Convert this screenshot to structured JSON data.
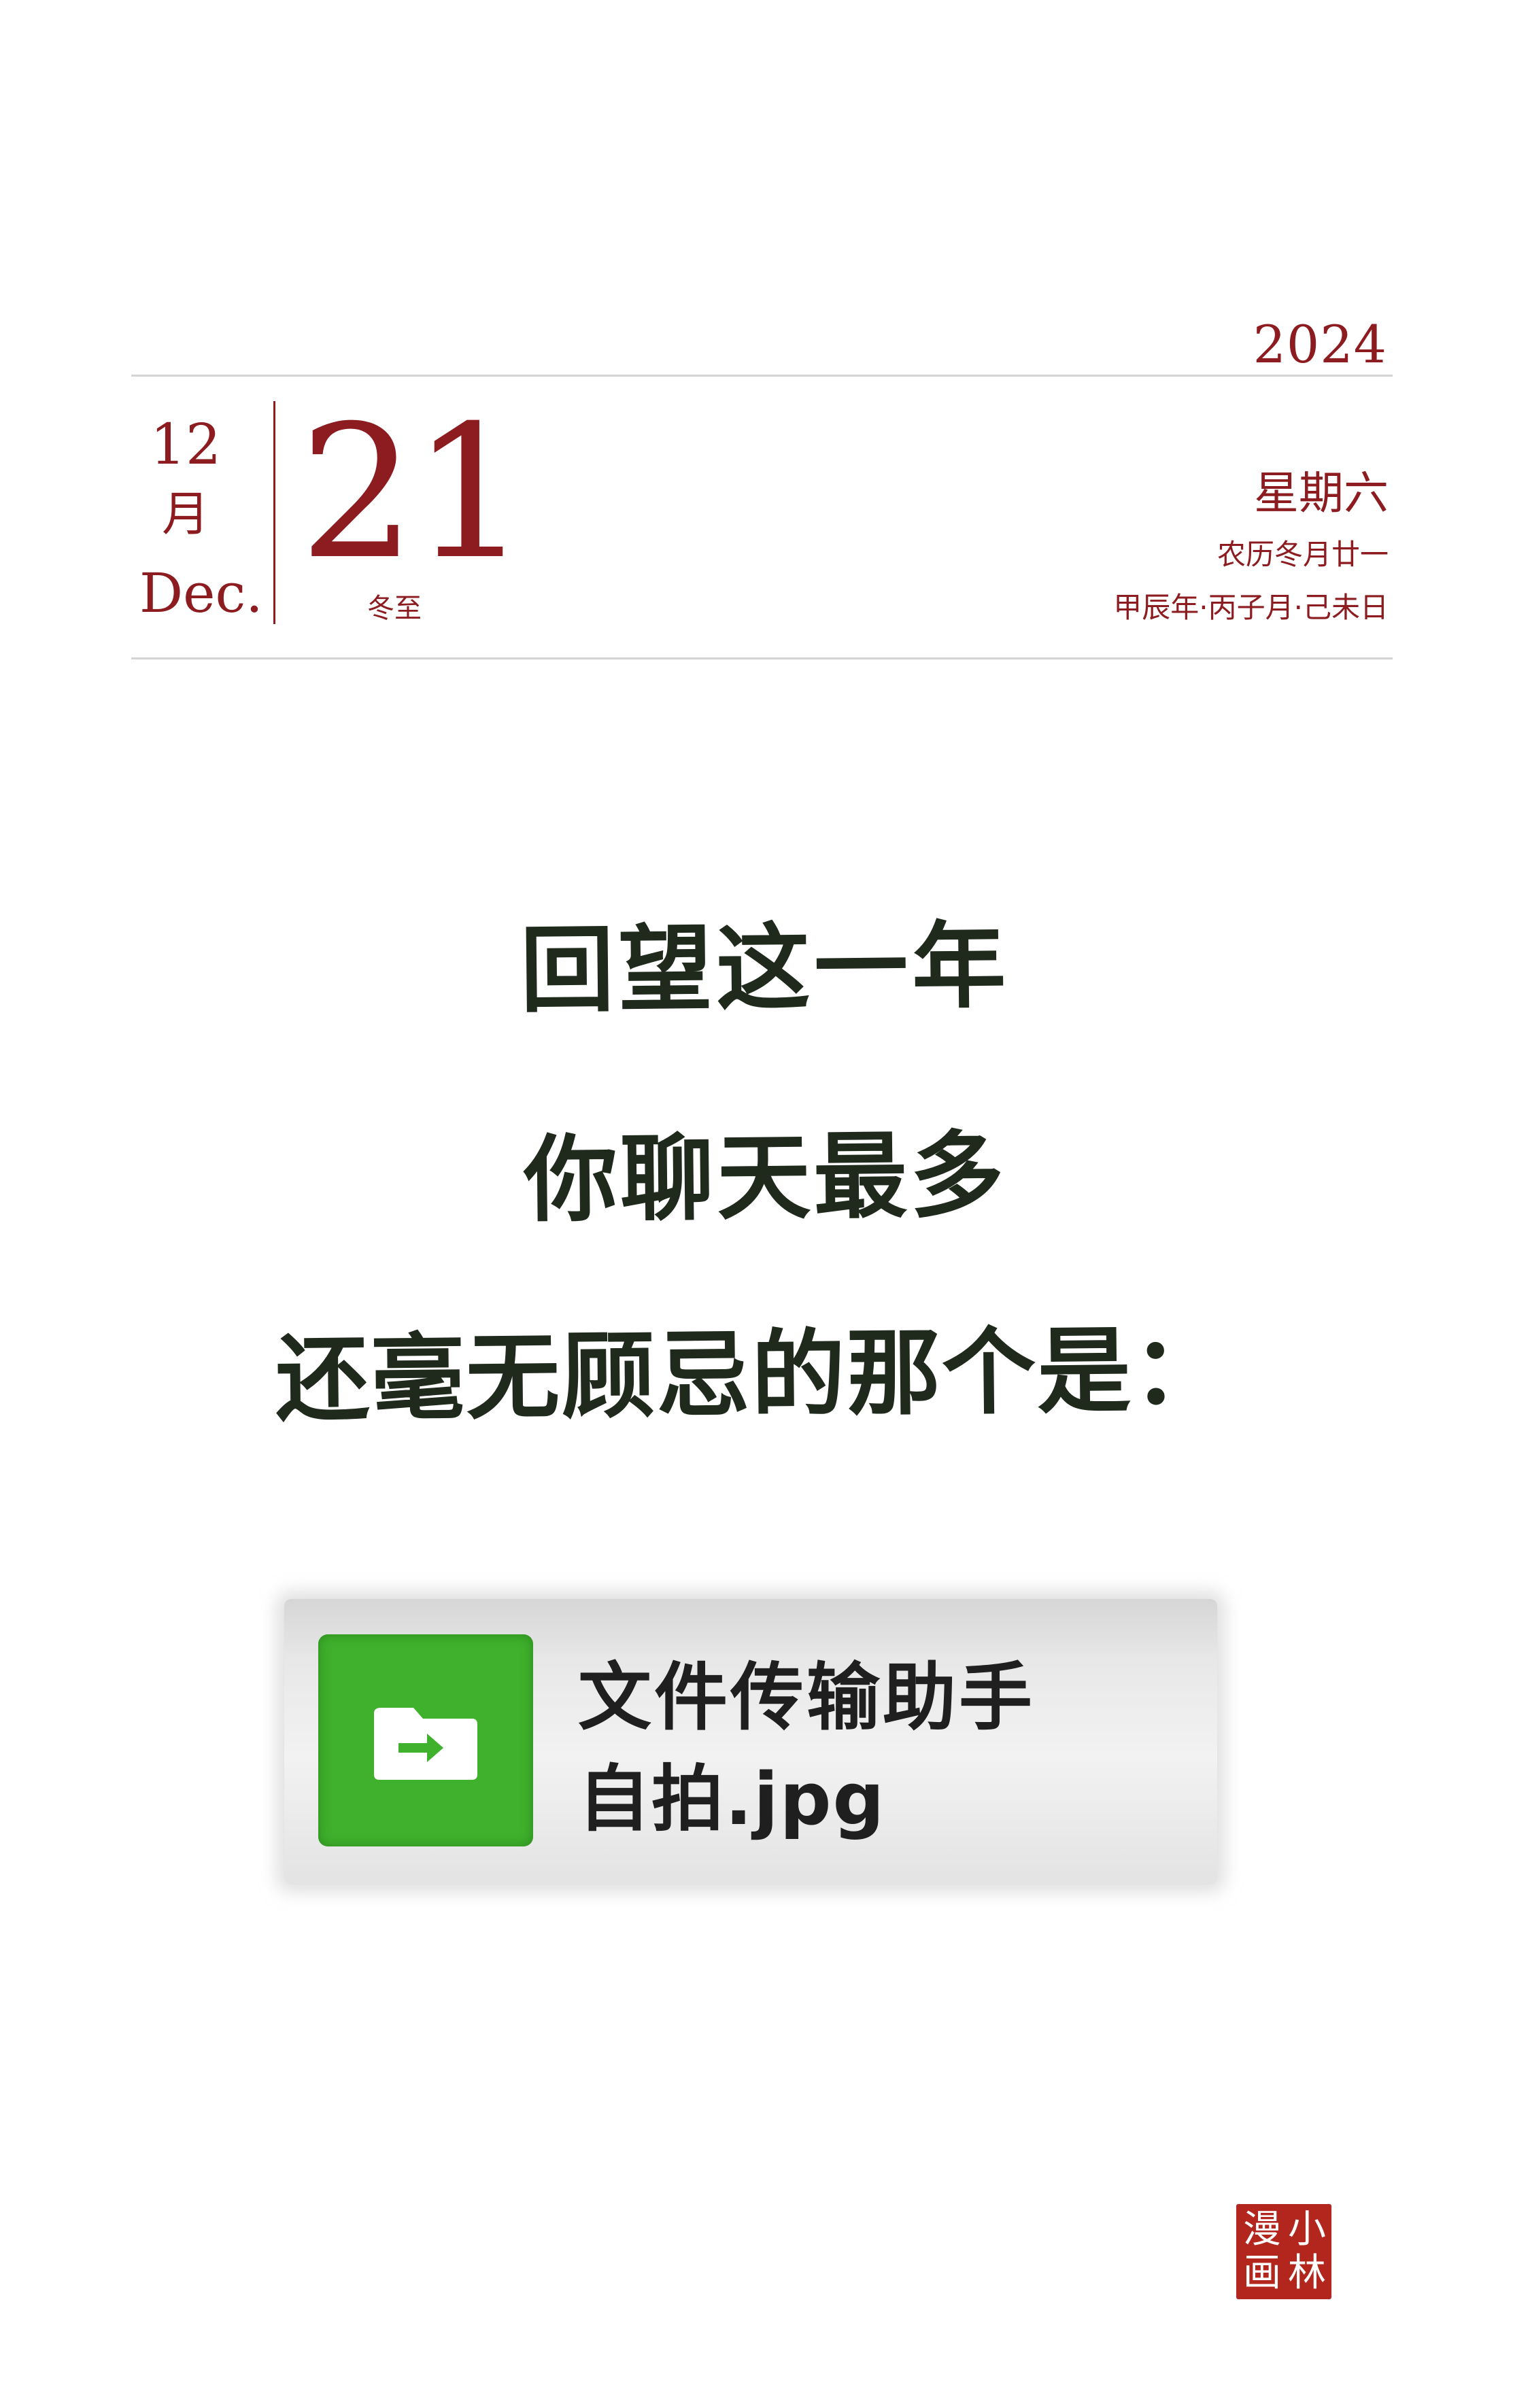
{
  "calendar": {
    "year": "2024",
    "month_num": "12",
    "month_cn": "月",
    "month_en": "Dec.",
    "day": "21",
    "solar_term": "冬至",
    "weekday": "星期六",
    "lunar_date": "农历冬月廿一",
    "ganzhi": "甲辰年·丙子月·己未日"
  },
  "message": {
    "line1": "回望这一年",
    "line2": "你聊天最多",
    "line3": "还毫无顾忌的那个是："
  },
  "chat_card": {
    "name": "文件传输助手",
    "last_message": "自拍.jpg",
    "avatar_icon": "folder-arrow-icon",
    "avatar_color": "#3fb12c"
  },
  "seal": {
    "chars": [
      "小",
      "林",
      "漫",
      "画"
    ],
    "color": "#b3261e"
  },
  "colors": {
    "accent": "#8c1c1f",
    "ink": "#1f2a1c"
  }
}
